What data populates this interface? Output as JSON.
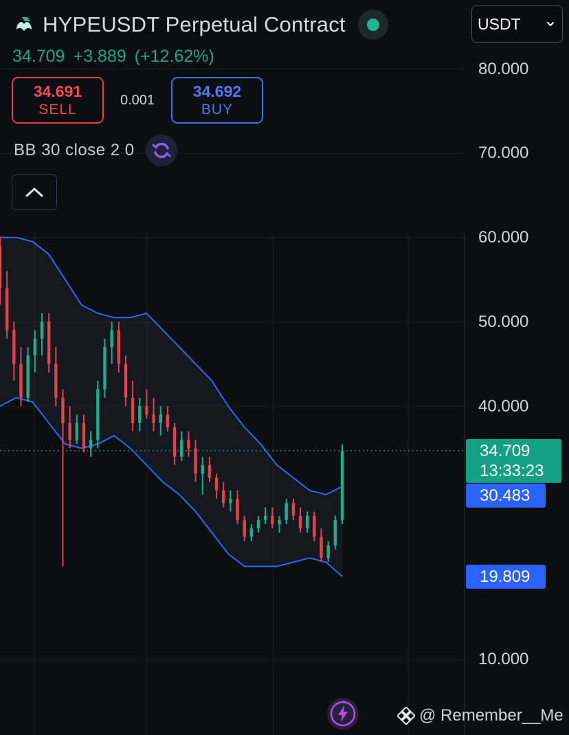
{
  "header": {
    "title": "HYPEUSDT Perpetual Contract",
    "last_price": "34.709",
    "change": "+3.889",
    "change_pct": "(+12.62%)",
    "sell_price": "34.691",
    "sell_label": "SELL",
    "spread": "0.001",
    "buy_price": "34.692",
    "buy_label": "BUY",
    "indicator": "BB 30 close 2 0",
    "currency": "USDT"
  },
  "axis": {
    "labels": [
      "80.000",
      "70.000",
      "60.000",
      "50.000",
      "40.000",
      "10.000"
    ]
  },
  "markers": {
    "price": "34.709",
    "countdown": "13:33:23",
    "bb_upper": "30.483",
    "bb_lower": "19.809"
  },
  "watermark": "@ Remember__Me",
  "colors": {
    "background": "#0c0e12",
    "up": "#1fae8b",
    "down": "#e0434f",
    "band": "#3167f0",
    "price_line": "#12a185"
  },
  "chart_data": {
    "type": "candlestick",
    "indicator": "BB 30 close 2 0",
    "ylim": [
      10,
      82
    ],
    "y_ticks": [
      80,
      70,
      60,
      50,
      40,
      10
    ],
    "last_price": 34.709,
    "candles": [
      [
        59,
        60,
        52,
        54
      ],
      [
        54,
        56,
        48,
        49
      ],
      [
        49,
        50,
        43,
        45
      ],
      [
        45,
        47,
        40,
        41
      ],
      [
        41,
        47,
        40.5,
        46
      ],
      [
        46,
        49,
        44,
        48
      ],
      [
        48,
        51,
        46,
        50
      ],
      [
        50,
        51,
        44,
        45
      ],
      [
        45,
        47,
        40,
        41
      ],
      [
        41,
        42,
        21,
        38
      ],
      [
        38,
        40,
        35,
        36
      ],
      [
        36,
        39,
        35.5,
        38
      ],
      [
        38,
        39,
        34.5,
        35
      ],
      [
        35,
        37,
        34,
        36
      ],
      [
        36,
        43,
        35,
        42
      ],
      [
        42,
        48,
        41,
        47
      ],
      [
        47,
        50,
        45,
        49
      ],
      [
        49,
        50,
        44,
        45
      ],
      [
        45,
        46,
        40,
        41
      ],
      [
        41,
        43,
        37,
        38
      ],
      [
        38,
        41,
        37,
        40
      ],
      [
        40,
        42,
        38.5,
        39
      ],
      [
        39,
        41,
        37,
        38
      ],
      [
        38,
        40,
        36.5,
        39
      ],
      [
        39,
        40,
        37,
        37.5
      ],
      [
        37.5,
        38,
        33,
        34
      ],
      [
        34,
        37,
        33.5,
        36
      ],
      [
        36,
        37,
        34,
        35
      ],
      [
        35,
        36,
        31,
        32
      ],
      [
        32,
        34,
        29.5,
        33
      ],
      [
        33,
        34,
        31,
        31.5
      ],
      [
        31.5,
        32,
        29,
        30
      ],
      [
        30,
        31,
        28,
        28.5
      ],
      [
        28.5,
        30,
        27.5,
        29
      ],
      [
        29,
        30,
        26,
        26.5
      ],
      [
        26.5,
        27,
        24,
        24.5
      ],
      [
        24.5,
        26,
        24,
        25.5
      ],
      [
        25.5,
        27,
        25,
        26.5
      ],
      [
        26.5,
        28,
        26,
        27
      ],
      [
        27,
        28,
        25.5,
        26
      ],
      [
        26,
        27,
        25,
        26.5
      ],
      [
        26.5,
        29,
        26,
        28.5
      ],
      [
        28.5,
        29,
        26.5,
        27
      ],
      [
        27,
        28,
        25,
        25.5
      ],
      [
        25.5,
        27.5,
        25,
        27
      ],
      [
        27,
        27.5,
        24,
        24.5
      ],
      [
        24.5,
        25.5,
        21.5,
        22
      ],
      [
        22,
        24,
        21.5,
        23.5
      ],
      [
        23.5,
        27,
        23,
        26.5
      ],
      [
        26.5,
        35.5,
        26,
        34.709
      ]
    ],
    "bb_upper": [
      60,
      60,
      59.5,
      58,
      55,
      52,
      51,
      50.5,
      50.5,
      51,
      49,
      47,
      45,
      43,
      40,
      37.5,
      35.5,
      33,
      31.5,
      30,
      29.5,
      30.483
    ],
    "bb_lower": [
      40,
      41,
      40.5,
      38,
      35.5,
      35,
      35.5,
      36.5,
      35,
      33,
      31,
      29.5,
      27.5,
      25,
      22.5,
      21,
      21,
      21,
      21.5,
      22,
      21.5,
      19.809
    ]
  }
}
